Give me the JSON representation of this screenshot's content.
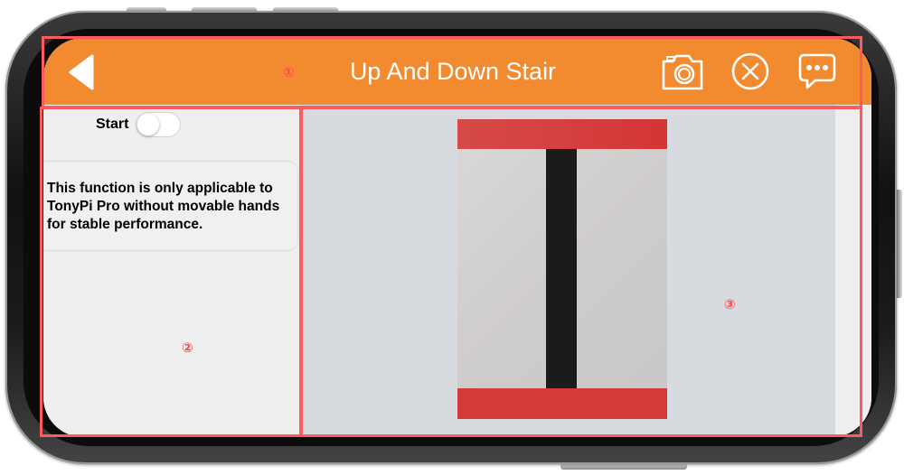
{
  "header": {
    "title": "Up And Down Stair",
    "back_icon": "back-arrow-icon",
    "camera_icon": "camera-icon",
    "close_icon": "close-circle-icon",
    "chat_icon": "chat-bubble-icon"
  },
  "left_panel": {
    "start_label": "Start",
    "toggle_on": false,
    "info_text": "This function is only applicable to TonyPi Pro without movable hands for stable performance."
  },
  "annotations": {
    "marker_1": "①",
    "marker_2": "②",
    "marker_3": "③"
  },
  "colors": {
    "accent": "#f28a2f",
    "annotation": "#ff5a5f",
    "stair_red": "#d33a3a",
    "stair_black": "#1b1b1b"
  }
}
